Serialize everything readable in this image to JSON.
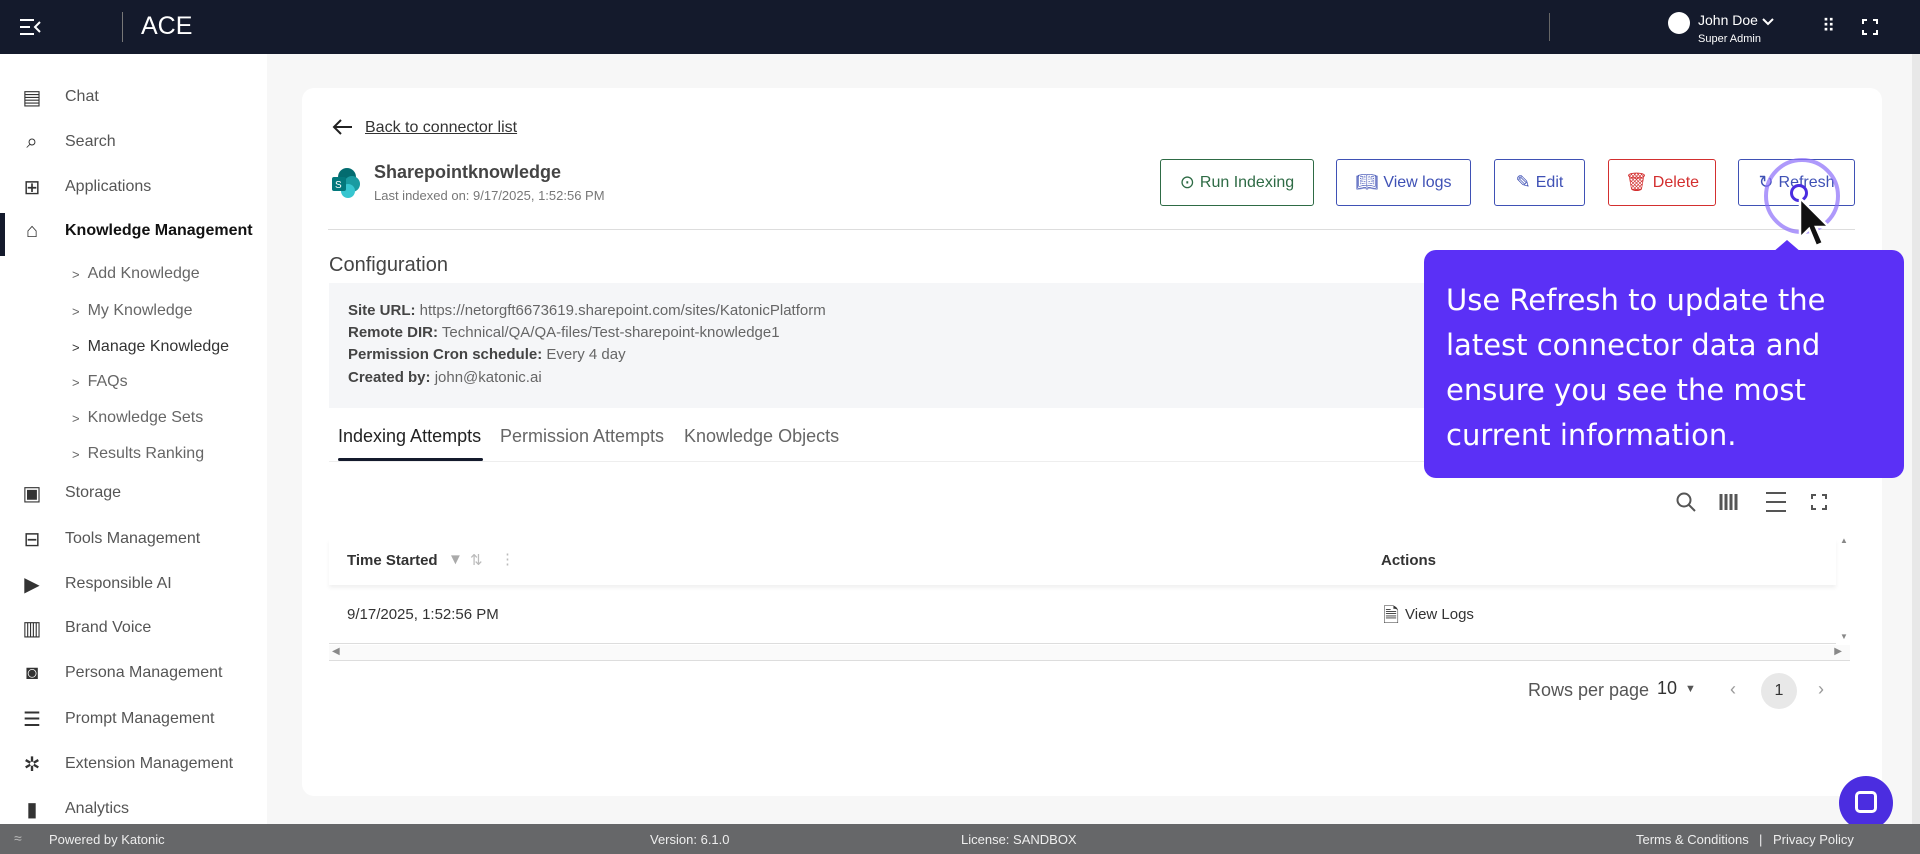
{
  "app": {
    "title": "ACE"
  },
  "user": {
    "name": "John Doe",
    "role": "Super Admin"
  },
  "sidebar": {
    "items": [
      {
        "label": "Chat",
        "icon": "chat-icon"
      },
      {
        "label": "Search",
        "icon": "search-icon"
      },
      {
        "label": "Applications",
        "icon": "apps-icon"
      },
      {
        "label": "Knowledge Management",
        "icon": "graduation-cap-icon"
      },
      {
        "label": "Storage",
        "icon": "storage-icon"
      },
      {
        "label": "Tools Management",
        "icon": "toolbox-icon"
      },
      {
        "label": "Responsible AI",
        "icon": "video-settings-icon"
      },
      {
        "label": "Brand Voice",
        "icon": "voice-icon"
      },
      {
        "label": "Persona Management",
        "icon": "persona-icon"
      },
      {
        "label": "Prompt Management",
        "icon": "prompt-icon"
      },
      {
        "label": "Extension Management",
        "icon": "puzzle-icon"
      },
      {
        "label": "Analytics",
        "icon": "bar-chart-icon"
      }
    ],
    "subitems": [
      "Add Knowledge",
      "My Knowledge",
      "Manage Knowledge",
      "FAQs",
      "Knowledge Sets",
      "Results Ranking"
    ]
  },
  "page": {
    "back": "Back to connector list",
    "title": "Sharepointknowledge",
    "subtitle": "Last indexed on: 9/17/2025, 1:52:56 PM",
    "buttons": {
      "run": "Run Indexing",
      "logs": "View logs",
      "edit": "Edit",
      "delete": "Delete",
      "refresh": "Refresh"
    },
    "config_title": "Configuration",
    "config": [
      {
        "k": "Site URL:",
        "v": " https://netorgft6673619.sharepoint.com/sites/KatonicPlatform"
      },
      {
        "k": "Remote DIR:",
        "v": " Technical/QA/QA-files/Test-sharepoint-knowledge1"
      },
      {
        "k": "Permission Cron schedule:",
        "v": " Every 4 day"
      },
      {
        "k": "Created by:",
        "v": " john@katonic.ai"
      }
    ],
    "tabs": [
      "Indexing Attempts",
      "Permission Attempts",
      "Knowledge Objects"
    ]
  },
  "table": {
    "headers": [
      "Time Started",
      "Actions"
    ],
    "rows": [
      {
        "time": "9/17/2025, 1:52:56 PM",
        "action": "View Logs"
      }
    ],
    "rows_per_page_label": "Rows per page",
    "rows_per_page": "10",
    "page": "1"
  },
  "tooltip": "Use Refresh to update the latest connector data and ensure you see the most current information.",
  "footer": {
    "powered": "Powered by Katonic",
    "version": "Version: 6.1.0",
    "license": "License: SANDBOX",
    "terms": "Terms & Conditions",
    "sep": "|",
    "privacy": "Privacy Policy"
  },
  "colors": {
    "topbar": "#141a2c",
    "accent": "#5b30f6",
    "green": "#2e6b45",
    "blue": "#3f51b5",
    "red": "#d32f2f"
  }
}
